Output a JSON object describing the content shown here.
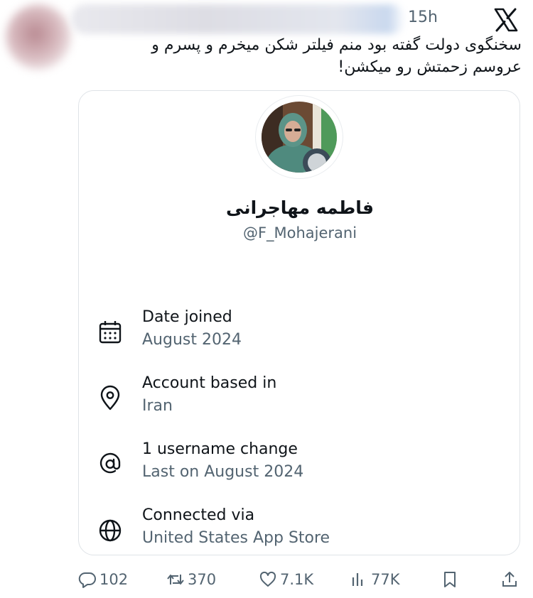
{
  "tweet": {
    "time": "15h",
    "text": "سخنگوی دولت گفته بود منم فیلتر شکن میخرم و پسرم و عروسم زحمتش رو میکشن!"
  },
  "card": {
    "display_name": "فاطمه مهاجرانی",
    "handle": "@F_Mohajerani",
    "rows": [
      {
        "icon": "calendar-icon",
        "title": "Date joined",
        "sub": "August 2024"
      },
      {
        "icon": "location-pin-icon",
        "title": "Account based in",
        "sub": "Iran"
      },
      {
        "icon": "at-sign-icon",
        "title": "1 username change",
        "sub": "Last on August 2024"
      },
      {
        "icon": "globe-icon",
        "title": "Connected via",
        "sub": "United States App Store"
      }
    ]
  },
  "actions": {
    "replies": "102",
    "reposts": "370",
    "likes": "7.1K",
    "views": "77K"
  },
  "colors": {
    "text": "#0f1419",
    "secondary": "#536471",
    "border": "#dfe3e7"
  }
}
